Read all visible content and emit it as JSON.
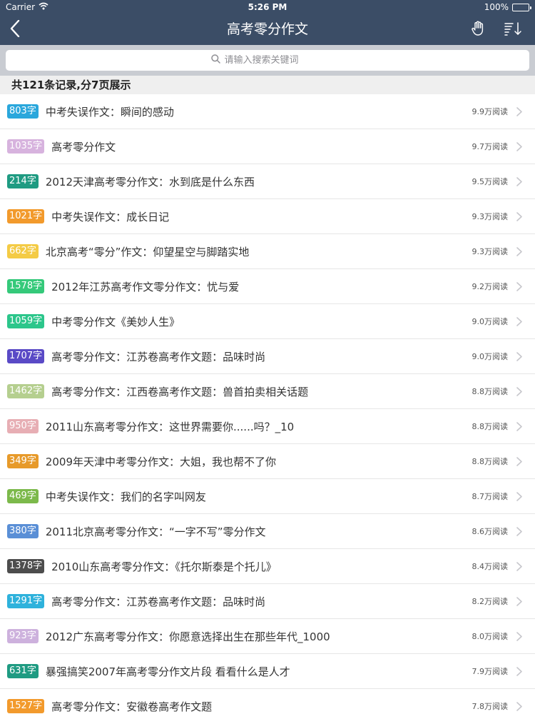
{
  "status_bar": {
    "carrier": "Carrier",
    "time": "5:26 PM",
    "battery": "100%",
    "battery_level": 1.0
  },
  "nav": {
    "title": "高考零分作文"
  },
  "search": {
    "placeholder": "请输入搜索关键词",
    "value": ""
  },
  "summary": "共121条记录,分7页展示",
  "items": [
    {
      "badge": "803字",
      "color": "#2aa7dc",
      "title": "中考失误作文：瞬间的感动",
      "reads": "9.9万阅读"
    },
    {
      "badge": "1035字",
      "color": "#d7b3de",
      "title": "高考零分作文",
      "reads": "9.7万阅读"
    },
    {
      "badge": "214字",
      "color": "#1f9b82",
      "title": "2012天津高考零分作文：水到底是什么东西",
      "reads": "9.5万阅读"
    },
    {
      "badge": "1021字",
      "color": "#f29a2c",
      "title": "中考失误作文：成长日记",
      "reads": "9.3万阅读"
    },
    {
      "badge": "662字",
      "color": "#f4cb45",
      "title": "北京高考“零分”作文：仰望星空与脚踏实地",
      "reads": "9.3万阅读"
    },
    {
      "badge": "1578字",
      "color": "#35c97a",
      "title": "2012年江苏高考作文零分作文：忧与爱",
      "reads": "9.2万阅读"
    },
    {
      "badge": "1059字",
      "color": "#2cc68b",
      "title": "中考零分作文《美妙人生》",
      "reads": "9.0万阅读"
    },
    {
      "badge": "1707字",
      "color": "#5a4ac6",
      "title": "高考零分作文：江苏卷高考作文题：品味时尚",
      "reads": "9.0万阅读"
    },
    {
      "badge": "1462字",
      "color": "#b5cf8f",
      "title": "高考零分作文：江西卷高考作文题：兽首拍卖相关话题",
      "reads": "8.8万阅读"
    },
    {
      "badge": "950字",
      "color": "#e7aeb4",
      "title": "2011山东高考零分作文：这世界需要你......吗？_10",
      "reads": "8.8万阅读"
    },
    {
      "badge": "349字",
      "color": "#e79a2a",
      "title": "2009年天津中考零分作文：大姐，我也帮不了你",
      "reads": "8.8万阅读"
    },
    {
      "badge": "469字",
      "color": "#7cb94b",
      "title": "中考失误作文：我们的名字叫网友",
      "reads": "8.7万阅读"
    },
    {
      "badge": "380字",
      "color": "#5a8fd6",
      "title": "2011北京高考零分作文：“一字不写”零分作文",
      "reads": "8.6万阅读"
    },
    {
      "badge": "1378字",
      "color": "#4d4d4d",
      "title": "2010山东高考零分作文：《托尔斯泰是个托儿》",
      "reads": "8.4万阅读"
    },
    {
      "badge": "1291字",
      "color": "#2eb2dc",
      "title": "高考零分作文：江苏卷高考作文题：品味时尚",
      "reads": "8.2万阅读"
    },
    {
      "badge": "923字",
      "color": "#cdb1dd",
      "title": "2012广东高考零分作文：你愿意选择出生在那些年代_1000",
      "reads": "8.0万阅读"
    },
    {
      "badge": "631字",
      "color": "#1f9b82",
      "title": "暴强搞笑2007年高考零分作文片段 看看什么是人才",
      "reads": "7.9万阅读"
    },
    {
      "badge": "1527字",
      "color": "#f29a2c",
      "title": "高考零分作文：安徽卷高考作文题",
      "reads": "7.8万阅读"
    }
  ]
}
